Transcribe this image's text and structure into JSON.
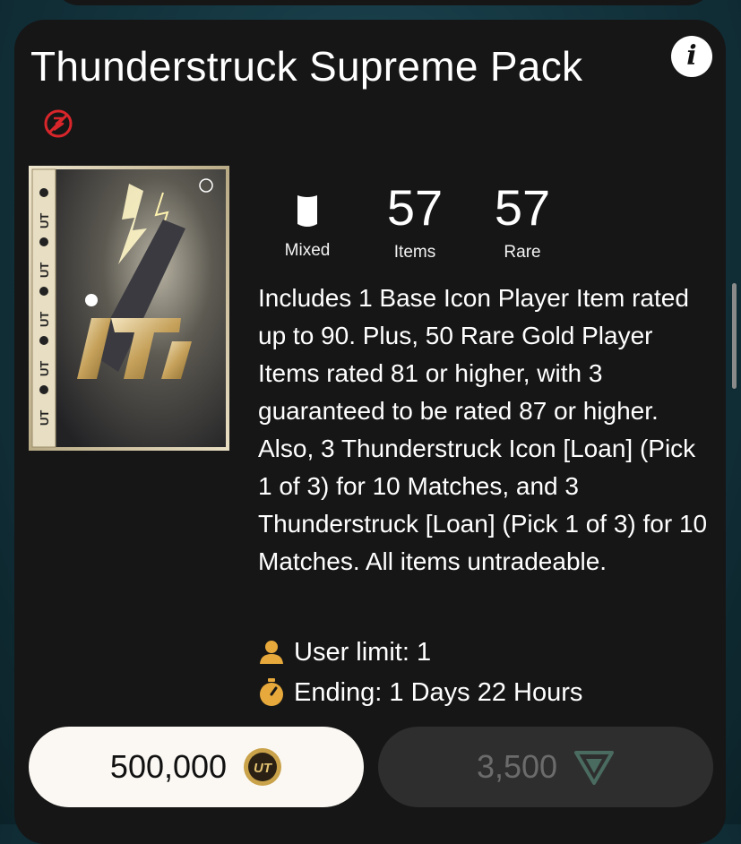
{
  "pack": {
    "title": "Thunderstruck Supreme Pack",
    "info_label": "i",
    "icons": {
      "untradeable": "no-trade-icon",
      "info": "info-icon",
      "kit": "shield-icon",
      "user": "user-icon",
      "timer": "stopwatch-icon",
      "coin": "coin-icon",
      "points": "fc-points-icon"
    },
    "stats": {
      "kit_label": "Mixed",
      "items_value": "57",
      "items_label": "Items",
      "rare_value": "57",
      "rare_label": "Rare"
    },
    "description": "Includes 1 Base Icon Player Item rated up to 90. Plus, 50 Rare Gold Player Items rated 81 or higher, with 3 guaranteed to be rated 87 or higher. Also, 3 Thunderstruck Icon [Loan] (Pick 1 of 3) for 10 Matches, and 3 Thunderstruck [Loan] (Pick 1 of 3) for 10 Matches. All items untradeable.",
    "user_limit": "User limit: 1",
    "ending": "Ending: 1 Days 22 Hours",
    "price_coins": "500,000",
    "price_points": "3,500",
    "image_lettering": [
      "UT",
      "UT",
      "UT",
      "UT",
      "UT",
      "UT"
    ],
    "colors": {
      "card_bg": "#161616",
      "accent_gold": "#e7a93b",
      "untradeable_red": "#d8262b",
      "coins_button_bg": "#fbf8f3",
      "points_button_bg": "#2e2e2e"
    }
  }
}
